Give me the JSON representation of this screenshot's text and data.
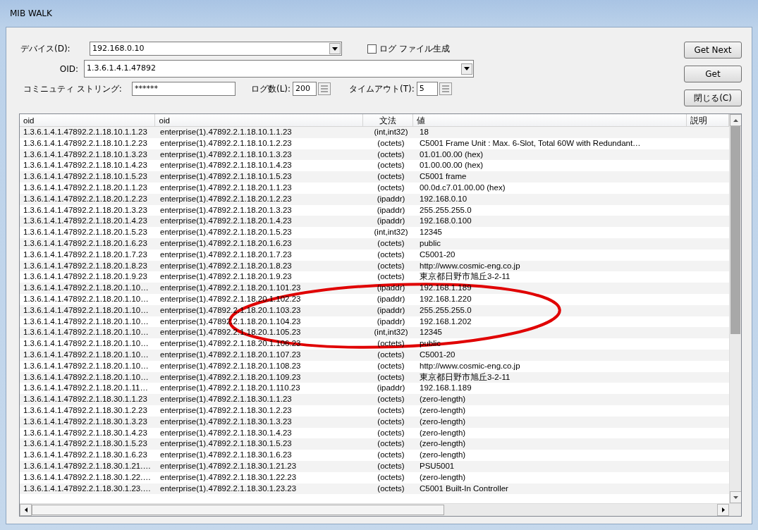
{
  "window": {
    "title": "MIB WALK"
  },
  "device": {
    "label": "デバイス(D):",
    "value": "192.168.0.10"
  },
  "log_file": {
    "label": "ログ ファイル生成",
    "checked": false
  },
  "oid": {
    "label": "OID:",
    "value": "1.3.6.1.4.1.47892"
  },
  "community": {
    "label": "コミニュティ ストリング:",
    "value": "******"
  },
  "log_count": {
    "label": "ログ数(L):",
    "value": "200"
  },
  "timeout": {
    "label": "タイムアウト(T):",
    "value": "5"
  },
  "buttons": [
    "Get Next",
    "Get",
    "閉じる(C)"
  ],
  "table": {
    "columns": [
      "oid",
      "oid",
      "文法",
      "値",
      "説明"
    ],
    "rows": [
      [
        "1.3.6.1.4.1.47892.2.1.18.10.1.1.23",
        "enterprise(1).47892.2.1.18.10.1.1.23",
        "(int,int32)",
        "18"
      ],
      [
        "1.3.6.1.4.1.47892.2.1.18.10.1.2.23",
        "enterprise(1).47892.2.1.18.10.1.2.23",
        "(octets)",
        "C5001 Frame Unit : Max. 6-Slot, Total 60W with Redundant…"
      ],
      [
        "1.3.6.1.4.1.47892.2.1.18.10.1.3.23",
        "enterprise(1).47892.2.1.18.10.1.3.23",
        "(octets)",
        "01.01.00.00 (hex)"
      ],
      [
        "1.3.6.1.4.1.47892.2.1.18.10.1.4.23",
        "enterprise(1).47892.2.1.18.10.1.4.23",
        "(octets)",
        "01.00.00.00 (hex)"
      ],
      [
        "1.3.6.1.4.1.47892.2.1.18.10.1.5.23",
        "enterprise(1).47892.2.1.18.10.1.5.23",
        "(octets)",
        "C5001 frame"
      ],
      [
        "1.3.6.1.4.1.47892.2.1.18.20.1.1.23",
        "enterprise(1).47892.2.1.18.20.1.1.23",
        "(octets)",
        "00.0d.c7.01.00.00 (hex)"
      ],
      [
        "1.3.6.1.4.1.47892.2.1.18.20.1.2.23",
        "enterprise(1).47892.2.1.18.20.1.2.23",
        "(ipaddr)",
        "192.168.0.10"
      ],
      [
        "1.3.6.1.4.1.47892.2.1.18.20.1.3.23",
        "enterprise(1).47892.2.1.18.20.1.3.23",
        "(ipaddr)",
        "255.255.255.0"
      ],
      [
        "1.3.6.1.4.1.47892.2.1.18.20.1.4.23",
        "enterprise(1).47892.2.1.18.20.1.4.23",
        "(ipaddr)",
        "192.168.0.100"
      ],
      [
        "1.3.6.1.4.1.47892.2.1.18.20.1.5.23",
        "enterprise(1).47892.2.1.18.20.1.5.23",
        "(int,int32)",
        "12345"
      ],
      [
        "1.3.6.1.4.1.47892.2.1.18.20.1.6.23",
        "enterprise(1).47892.2.1.18.20.1.6.23",
        "(octets)",
        "public"
      ],
      [
        "1.3.6.1.4.1.47892.2.1.18.20.1.7.23",
        "enterprise(1).47892.2.1.18.20.1.7.23",
        "(octets)",
        "C5001-20"
      ],
      [
        "1.3.6.1.4.1.47892.2.1.18.20.1.8.23",
        "enterprise(1).47892.2.1.18.20.1.8.23",
        "(octets)",
        "http://www.cosmic-eng.co.jp"
      ],
      [
        "1.3.6.1.4.1.47892.2.1.18.20.1.9.23",
        "enterprise(1).47892.2.1.18.20.1.9.23",
        "(octets)",
        "東京都日野市旭丘3-2-11"
      ],
      [
        "1.3.6.1.4.1.47892.2.1.18.20.1.10…",
        "enterprise(1).47892.2.1.18.20.1.101.23",
        "(ipaddr)",
        "192.168.1.189"
      ],
      [
        "1.3.6.1.4.1.47892.2.1.18.20.1.10…",
        "enterprise(1).47892.2.1.18.20.1.102.23",
        "(ipaddr)",
        "192.168.1.220"
      ],
      [
        "1.3.6.1.4.1.47892.2.1.18.20.1.10…",
        "enterprise(1).47892.2.1.18.20.1.103.23",
        "(ipaddr)",
        "255.255.255.0"
      ],
      [
        "1.3.6.1.4.1.47892.2.1.18.20.1.10…",
        "enterprise(1).47892.2.1.18.20.1.104.23",
        "(ipaddr)",
        "192.168.1.202"
      ],
      [
        "1.3.6.1.4.1.47892.2.1.18.20.1.10…",
        "enterprise(1).47892.2.1.18.20.1.105.23",
        "(int,int32)",
        "12345"
      ],
      [
        "1.3.6.1.4.1.47892.2.1.18.20.1.10…",
        "enterprise(1).47892.2.1.18.20.1.106.23",
        "(octets)",
        "public"
      ],
      [
        "1.3.6.1.4.1.47892.2.1.18.20.1.10…",
        "enterprise(1).47892.2.1.18.20.1.107.23",
        "(octets)",
        "C5001-20"
      ],
      [
        "1.3.6.1.4.1.47892.2.1.18.20.1.10…",
        "enterprise(1).47892.2.1.18.20.1.108.23",
        "(octets)",
        "http://www.cosmic-eng.co.jp"
      ],
      [
        "1.3.6.1.4.1.47892.2.1.18.20.1.10…",
        "enterprise(1).47892.2.1.18.20.1.109.23",
        "(octets)",
        "東京都日野市旭丘3-2-11"
      ],
      [
        "1.3.6.1.4.1.47892.2.1.18.20.1.11…",
        "enterprise(1).47892.2.1.18.20.1.110.23",
        "(ipaddr)",
        "192.168.1.189"
      ],
      [
        "1.3.6.1.4.1.47892.2.1.18.30.1.1.23",
        "enterprise(1).47892.2.1.18.30.1.1.23",
        "(octets)",
        "(zero-length)"
      ],
      [
        "1.3.6.1.4.1.47892.2.1.18.30.1.2.23",
        "enterprise(1).47892.2.1.18.30.1.2.23",
        "(octets)",
        "(zero-length)"
      ],
      [
        "1.3.6.1.4.1.47892.2.1.18.30.1.3.23",
        "enterprise(1).47892.2.1.18.30.1.3.23",
        "(octets)",
        "(zero-length)"
      ],
      [
        "1.3.6.1.4.1.47892.2.1.18.30.1.4.23",
        "enterprise(1).47892.2.1.18.30.1.4.23",
        "(octets)",
        "(zero-length)"
      ],
      [
        "1.3.6.1.4.1.47892.2.1.18.30.1.5.23",
        "enterprise(1).47892.2.1.18.30.1.5.23",
        "(octets)",
        "(zero-length)"
      ],
      [
        "1.3.6.1.4.1.47892.2.1.18.30.1.6.23",
        "enterprise(1).47892.2.1.18.30.1.6.23",
        "(octets)",
        "(zero-length)"
      ],
      [
        "1.3.6.1.4.1.47892.2.1.18.30.1.21.…",
        "enterprise(1).47892.2.1.18.30.1.21.23",
        "(octets)",
        "PSU5001"
      ],
      [
        "1.3.6.1.4.1.47892.2.1.18.30.1.22.…",
        "enterprise(1).47892.2.1.18.30.1.22.23",
        "(octets)",
        "(zero-length)"
      ],
      [
        "1.3.6.1.4.1.47892.2.1.18.30.1.23.…",
        "enterprise(1).47892.2.1.18.30.1.23.23",
        "(octets)",
        "C5001 Built-In Controller"
      ]
    ]
  }
}
